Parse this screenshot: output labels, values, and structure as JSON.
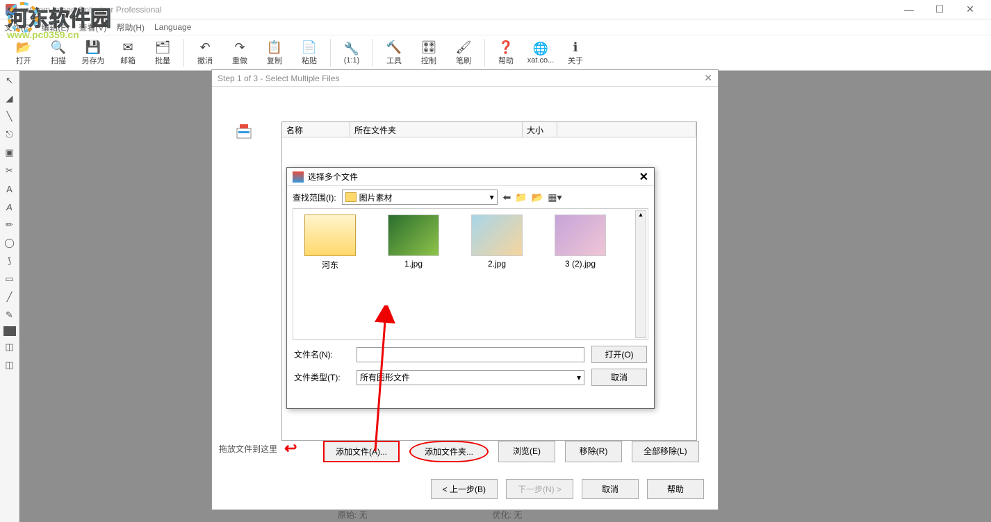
{
  "app": {
    "title": "xat.com Image Optimizer Professional"
  },
  "watermark": {
    "text": "河东软件园",
    "url": "www.pc0359.cn"
  },
  "menubar": [
    "文件(F)",
    "编辑(E)",
    "查看(V)",
    "帮助(H)",
    "Language"
  ],
  "toolbar": [
    {
      "label": "打开",
      "icon": "📂"
    },
    {
      "label": "扫描",
      "icon": "🔍"
    },
    {
      "label": "另存为",
      "icon": "💾"
    },
    {
      "label": "邮箱",
      "icon": "✉"
    },
    {
      "label": "批量",
      "icon": "🗂"
    },
    {
      "sep": true
    },
    {
      "label": "撤消",
      "icon": "↶"
    },
    {
      "label": "重做",
      "icon": "↷"
    },
    {
      "label": "复制",
      "icon": "📋"
    },
    {
      "label": "粘贴",
      "icon": "📄"
    },
    {
      "sep": true
    },
    {
      "label": "(1:1)",
      "icon": "🔧"
    },
    {
      "sep": true
    },
    {
      "label": "工具",
      "icon": "🔨"
    },
    {
      "label": "控制",
      "icon": "🎛"
    },
    {
      "label": "笔刷",
      "icon": "🖌"
    },
    {
      "sep": true
    },
    {
      "label": "帮助",
      "icon": "❓"
    },
    {
      "label": "xat.co...",
      "icon": "🌐"
    },
    {
      "label": "关于",
      "icon": "ℹ"
    }
  ],
  "step_dialog": {
    "title": "Step 1 of 3 - Select Multiple Files",
    "columns": {
      "name": "名称",
      "folder": "所在文件夹",
      "size": "大小"
    },
    "drag_label": "拖放文件到这里",
    "buttons": {
      "add_file": "添加文件(A)...",
      "add_folder": "添加文件夹...",
      "browse": "浏览(E)",
      "remove": "移除(R)",
      "remove_all": "全部移除(L)"
    },
    "nav": {
      "prev": "< 上一步(B)",
      "next": "下一步(N) >",
      "cancel": "取消",
      "help": "帮助"
    }
  },
  "browser": {
    "title": "选择多个文件",
    "look_in_label": "查找范围(I):",
    "look_in_value": "图片素材",
    "files": [
      {
        "name": "河东",
        "type": "folder"
      },
      {
        "name": "1.jpg",
        "type": "image"
      },
      {
        "name": "2.jpg",
        "type": "image"
      },
      {
        "name": "3 (2).jpg",
        "type": "image"
      }
    ],
    "filename_label": "文件名(N):",
    "filename_value": "",
    "filetype_label": "文件类型(T):",
    "filetype_value": "所有图形文件",
    "open": "打开(O)",
    "cancel": "取消"
  },
  "status": {
    "original": "原始: 无",
    "optimized": "优化: 无"
  }
}
